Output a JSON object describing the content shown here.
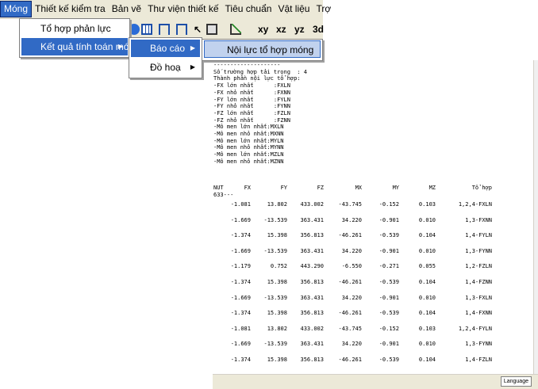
{
  "menubar": {
    "items": [
      "Móng",
      "Thiết kế kiểm tra",
      "Bản vẽ",
      "Thư viện thiết kế",
      "Tiêu chuẩn",
      "Vật liệu",
      "Trợ"
    ]
  },
  "toolbar": {
    "labels": [
      "xy",
      "xz",
      "yz",
      "3d"
    ]
  },
  "menu_mong": {
    "items": [
      "Tổ hợp phản lực",
      "Kết quả tính toán móng"
    ]
  },
  "menu_ketqua": {
    "items": [
      "Báo cáo",
      "Đồ hoạ"
    ]
  },
  "menu_baocao": {
    "items": [
      "Nội lực tổ hợp móng"
    ]
  },
  "report": {
    "header_lines": [
      "--------------------",
      "Số trường hợp tải trọng  : 4",
      "Thành phần nội lực tổ hợp:",
      "-FX lớn nhất      :FXLN",
      "-FX nhỏ nhất      :FXNN",
      "-FY lớn nhất      :FYLN",
      "-FY nhỏ nhất      :FYNN",
      "-FZ lớn nhất      :FZLN",
      "-FZ nhỏ nhất      :FZNN",
      "-Mô men lớn nhất:MXLN",
      "-Mô men nhỏ nhất:MXNN",
      "-Mô men lớn nhất:MYLN",
      "-Mô men nhỏ nhất:MYNN",
      "-Mô men lớn nhất:MZLN",
      "-Mô men nhỏ nhất:MZNN"
    ],
    "columns": [
      "NUT",
      "FX",
      "FY",
      "FZ",
      "MX",
      "MY",
      "MZ",
      "Tổ hợp"
    ],
    "node": "633---",
    "rows": [
      [
        "-1.081",
        "13.802",
        "433.002",
        "-43.745",
        "-0.152",
        "0.103",
        "1,2,4-FXLN"
      ],
      [
        "-1.669",
        "-13.539",
        "363.431",
        "34.220",
        "-0.901",
        "0.010",
        "1,3-FXNN"
      ],
      [
        "-1.374",
        "15.398",
        "356.813",
        "-46.261",
        "-0.539",
        "0.104",
        "1,4-FYLN"
      ],
      [
        "-1.669",
        "-13.539",
        "363.431",
        "34.220",
        "-0.901",
        "0.010",
        "1,3-FYNN"
      ],
      [
        "-1.179",
        "0.752",
        "443.290",
        "-6.550",
        "-0.271",
        "0.055",
        "1,2-FZLN"
      ],
      [
        "-1.374",
        "15.398",
        "356.813",
        "-46.261",
        "-0.539",
        "0.104",
        "1,4-FZNN"
      ],
      [
        "-1.669",
        "-13.539",
        "363.431",
        "34.220",
        "-0.901",
        "0.010",
        "1,3-FXLN"
      ],
      [
        "-1.374",
        "15.398",
        "356.813",
        "-46.261",
        "-0.539",
        "0.104",
        "1,4-FXNN"
      ],
      [
        "-1.081",
        "13.802",
        "433.002",
        "-43.745",
        "-0.152",
        "0.103",
        "1,2,4-FYLN"
      ],
      [
        "-1.669",
        "-13.539",
        "363.431",
        "34.220",
        "-0.901",
        "0.010",
        "1,3-FYNN"
      ],
      [
        "-1.374",
        "15.398",
        "356.813",
        "-46.261",
        "-0.539",
        "0.104",
        "1,4-FZLN"
      ]
    ]
  },
  "statusbar": {
    "language": "Language"
  }
}
